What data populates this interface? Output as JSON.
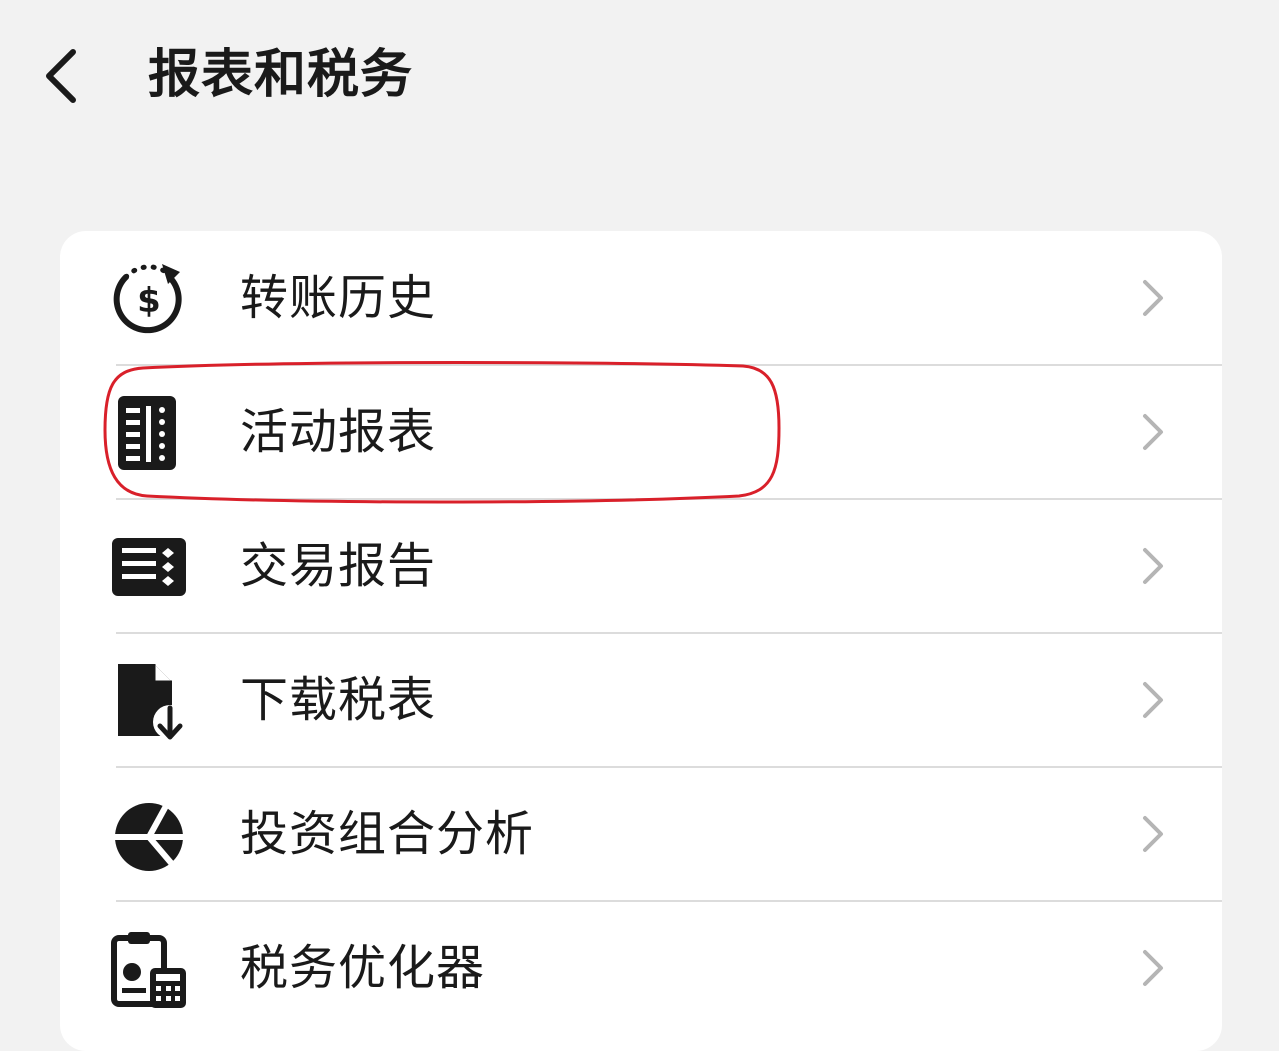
{
  "header": {
    "back_icon": "chevron-left-icon",
    "title": "报表和税务"
  },
  "menu": {
    "items": [
      {
        "label": "转账历史",
        "icon": "dollar-history-icon"
      },
      {
        "label": "活动报表",
        "icon": "statement-list-icon"
      },
      {
        "label": "交易报告",
        "icon": "trade-report-icon"
      },
      {
        "label": "下载税表",
        "icon": "document-download-icon"
      },
      {
        "label": "投资组合分析",
        "icon": "pie-chart-icon"
      },
      {
        "label": "税务优化器",
        "icon": "clipboard-calculator-icon"
      }
    ],
    "chevron_icon": "chevron-right-icon"
  },
  "highlight": {
    "target": "活动报表",
    "color": "#d9202a"
  },
  "colors": {
    "background": "#f2f2f2",
    "card": "#ffffff",
    "text": "#1a1a1a",
    "chevron": "#b5b5b5",
    "divider": "#dcdcdc"
  }
}
